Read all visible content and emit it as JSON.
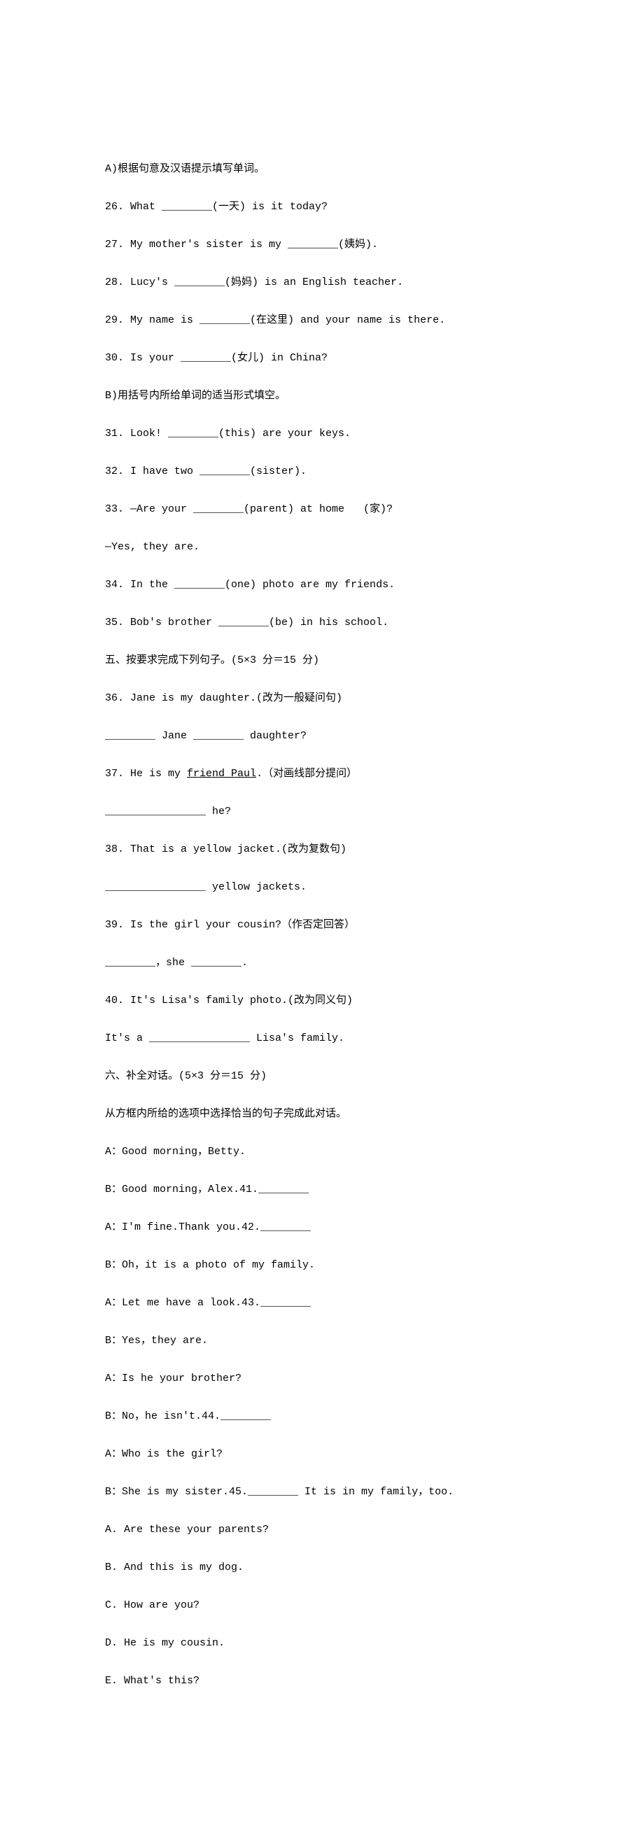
{
  "sectionA": {
    "heading": "A)根据句意及汉语提示填写单词。",
    "items": [
      "26. What ________(一天) is it today?",
      "27. My mother's sister is my ________(姨妈).",
      "28. Lucy's ________(妈妈) is an English teacher.",
      "29. My name is ________(在这里) and your name is there.",
      "30. Is your ________(女儿) in China?"
    ]
  },
  "sectionB": {
    "heading": "B)用括号内所给单词的适当形式填空。",
    "items": [
      "31. Look! ________(this) are your keys.",
      "32. I have two ________(sister).",
      "33. —Are your ________(parent) at home   (家)?",
      "—Yes, they are.",
      "34. In the ________(one) photo are my friends.",
      "35. Bob's brother ________(be) in his school."
    ]
  },
  "section5": {
    "heading": "五、按要求完成下列句子。(5×3 分＝15 分)",
    "items": [
      "36. Jane is my daughter.(改为一般疑问句)",
      "________ Jane ________ daughter?",
      "37. He is my ",
      ".（对画线部分提问）",
      "________________ he?",
      "38. That is a yellow jacket.(改为复数句)",
      "________________ yellow jackets.",
      "39. Is the girl your cousin?（作否定回答）",
      "________，she ________.",
      "40. It's Lisa's family photo.(改为同义句)",
      "It's a ________________ Lisa's family."
    ],
    "underlined": "friend Paul"
  },
  "section6": {
    "heading": "六、补全对话。(5×3 分＝15 分)",
    "instruction": "从方框内所给的选项中选择恰当的句子完成此对话。",
    "dialogue": [
      "A：Good morning，Betty.",
      "B：Good morning，Alex.41.________",
      "A：I'm fine.Thank you.42.________",
      "B：Oh，it is a photo of my family.",
      "A：Let me have a look.43.________",
      "B：Yes，they are.",
      "A：Is he your brother?",
      "B：No，he isn't.44.________",
      "A：Who is the girl?",
      "B：She is my sister.45.________ It is in my family，too."
    ],
    "options": [
      "A. Are these your parents?",
      "B. And this is my dog.",
      "C. How are you?",
      "D. He is my cousin.",
      "E. What's this?"
    ]
  }
}
